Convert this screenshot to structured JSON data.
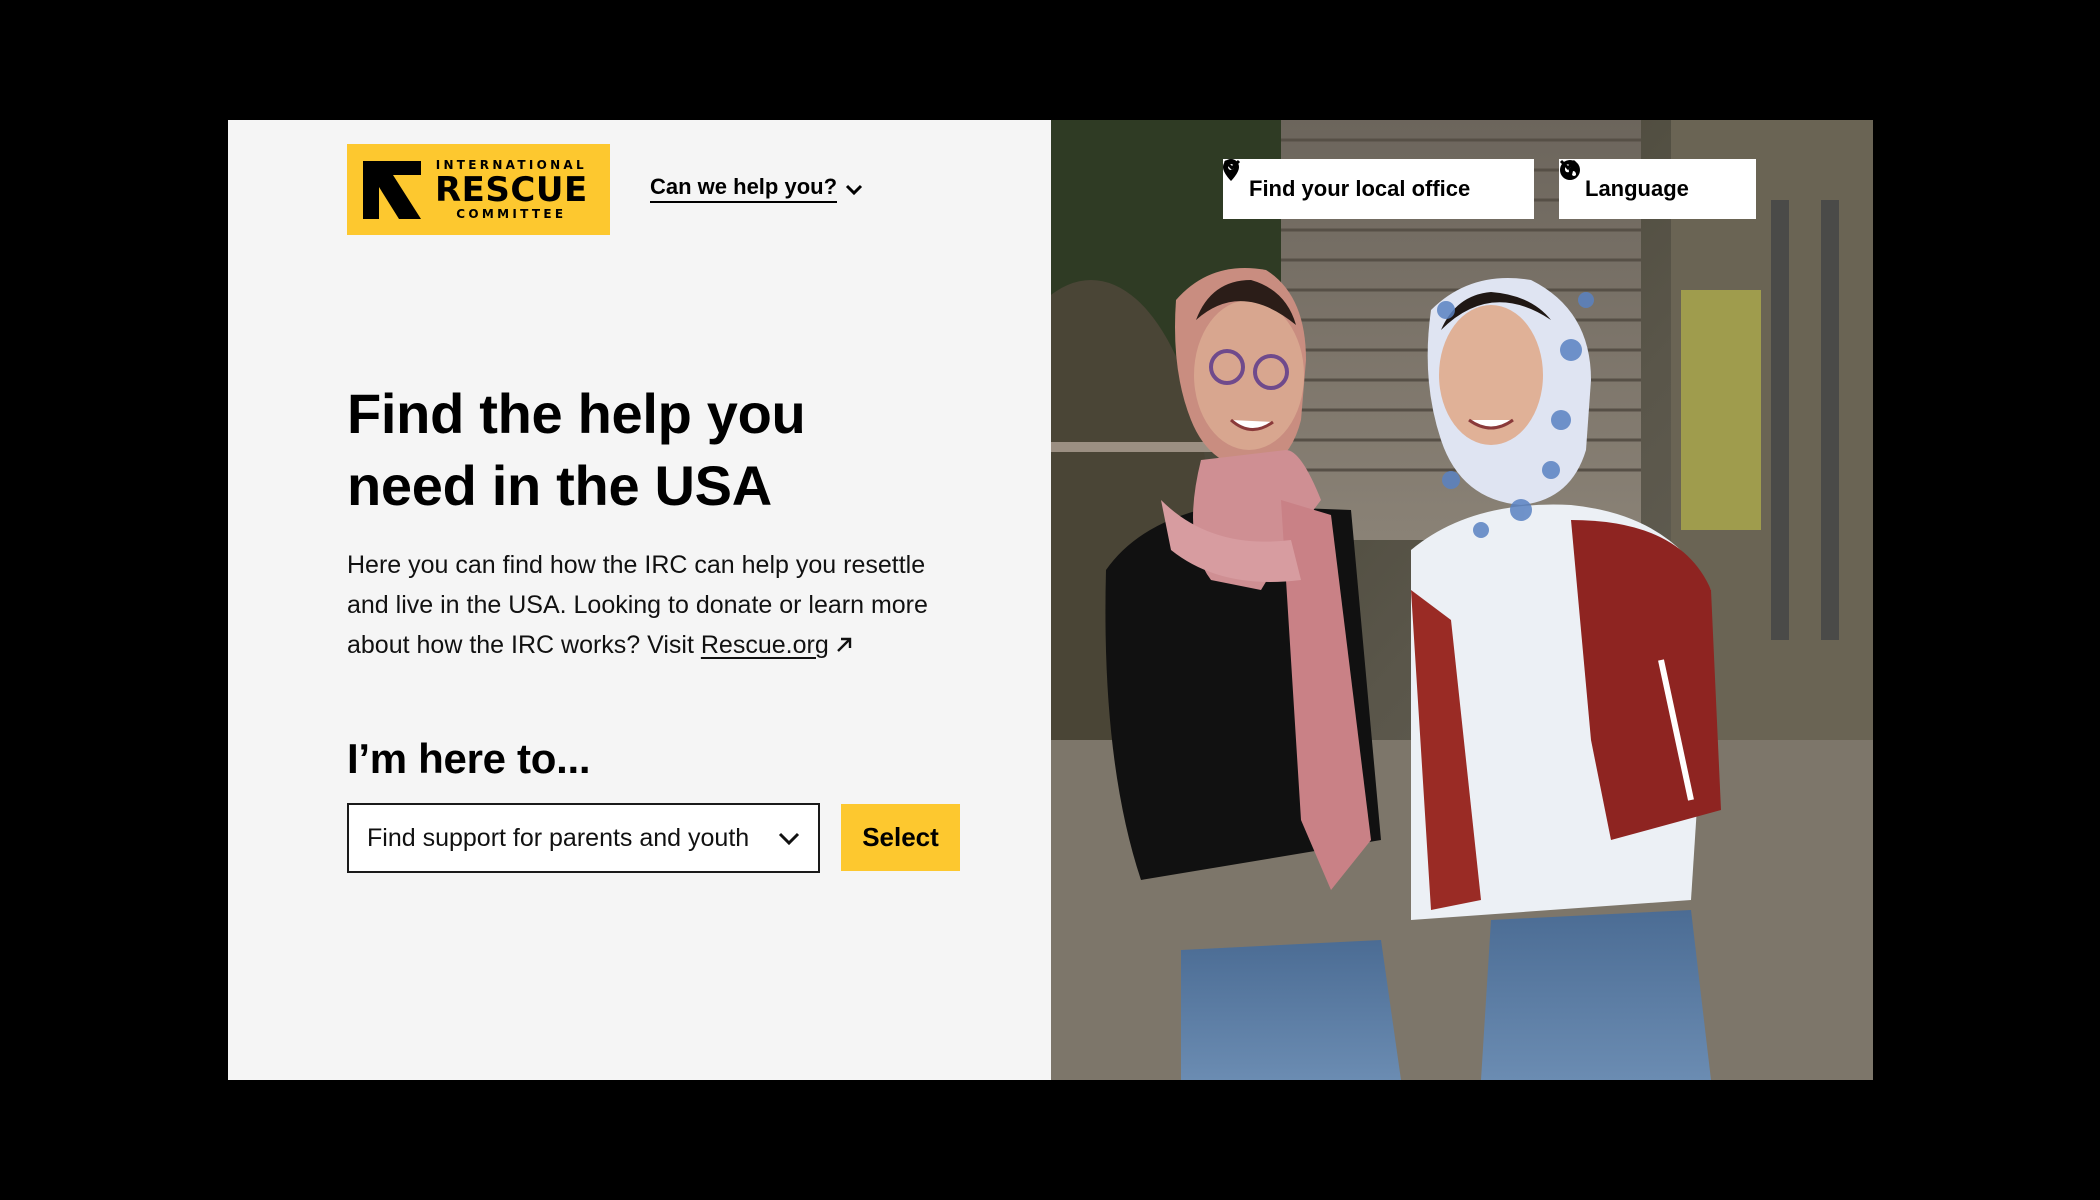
{
  "logo": {
    "line1": "INTERNATIONAL",
    "line2": "RESCUE",
    "line3": "COMMITTEE",
    "color": "#fdc82f"
  },
  "header": {
    "help_link": "Can we help you?",
    "office_label": "Find your local office",
    "language_label": "Language"
  },
  "hero": {
    "title": "Find the help you need in the USA",
    "body_text": "Here you can find how the IRC can help you resettle and live in the USA. Looking to donate or learn more about how the IRC works? Visit ",
    "link_text": "Rescue.org"
  },
  "selector": {
    "heading": "I’m here to...",
    "selected_value": "Find support for parents and youth",
    "button_label": "Select"
  },
  "icons": [
    "irc-logo-icon",
    "chevron-down-icon",
    "external-arrow-icon",
    "map-pin-icon",
    "globe-icon"
  ],
  "colors": {
    "accent": "#fdc82f",
    "panel": "#f5f5f5",
    "background": "#000000"
  }
}
